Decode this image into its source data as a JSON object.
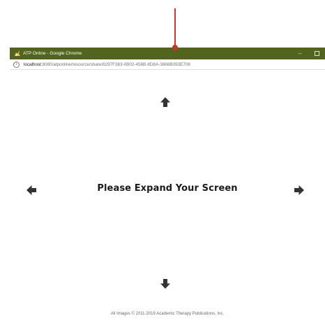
{
  "window": {
    "title": "ATP Online - Google Chrome",
    "minimize_glyph": "–",
    "titlebar_color": "#52641e"
  },
  "address_bar": {
    "host": "localhost",
    "path": ":8080/atponline/resource/share/8297F383-0B02-456B-8D8A-3666B093E706",
    "icon": "info-icon"
  },
  "page": {
    "message": "Please Expand Your Screen",
    "footer": "All Images © 2011-2019 Academic Therapy Publications, Inc.",
    "arrows": [
      "arrow-up-icon",
      "arrow-down-icon",
      "arrow-left-icon",
      "arrow-right-icon"
    ]
  },
  "annotation": {
    "pointer_color": "#c0392b"
  }
}
